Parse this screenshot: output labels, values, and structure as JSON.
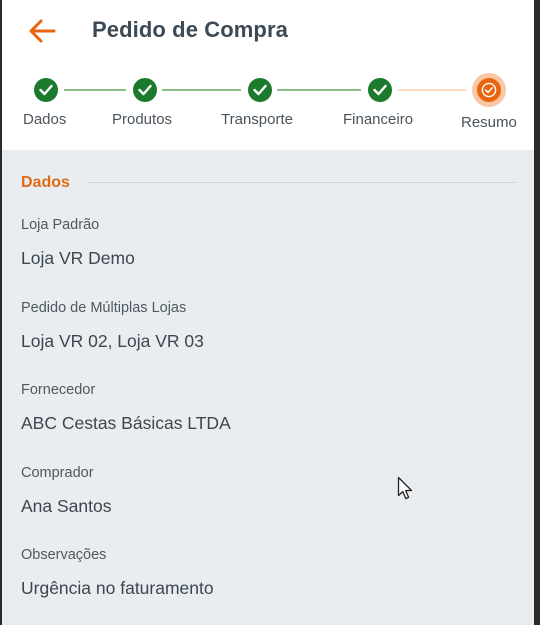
{
  "header": {
    "title": "Pedido de Compra",
    "back_icon": "arrow-left-icon"
  },
  "stepper": {
    "steps": [
      {
        "label": "Dados",
        "status": "done"
      },
      {
        "label": "Produtos",
        "status": "done"
      },
      {
        "label": "Transporte",
        "status": "done"
      },
      {
        "label": "Financeiro",
        "status": "done"
      },
      {
        "label": "Resumo",
        "status": "active"
      }
    ]
  },
  "section": {
    "title": "Dados"
  },
  "fields": [
    {
      "label": "Loja Padrão",
      "value": "Loja VR Demo"
    },
    {
      "label": "Pedido de Múltiplas Lojas",
      "value": "Loja VR 02, Loja VR 03"
    },
    {
      "label": "Fornecedor",
      "value": "ABC Cestas Básicas LTDA"
    },
    {
      "label": "Comprador",
      "value": "Ana Santos"
    },
    {
      "label": "Observações",
      "value": "Urgência no faturamento"
    }
  ],
  "colors": {
    "accent": "#e8650e",
    "done": "#1c7a2c",
    "background": "#eaedf0"
  }
}
